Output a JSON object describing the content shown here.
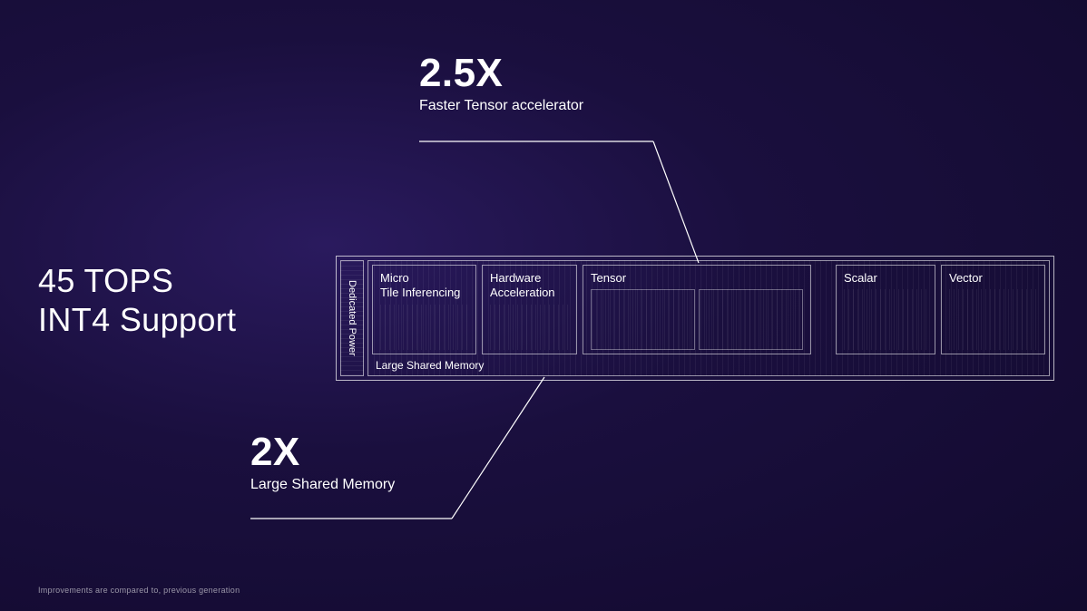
{
  "headline": {
    "line1": "45 TOPS",
    "line2": "INT4 Support"
  },
  "callouts": {
    "top": {
      "value": "2.5X",
      "label": "Faster Tensor accelerator"
    },
    "bottom": {
      "value": "2X",
      "label": "Large Shared Memory"
    }
  },
  "chip": {
    "dedicated_power": "Dedicated Power",
    "blocks": {
      "micro": "Micro\nTile Inferencing",
      "hardware": "Hardware\nAcceleration",
      "tensor": "Tensor",
      "scalar": "Scalar",
      "vector": "Vector"
    },
    "memory": "Large Shared Memory"
  },
  "footnote": "Improvements are compared to, previous generation"
}
